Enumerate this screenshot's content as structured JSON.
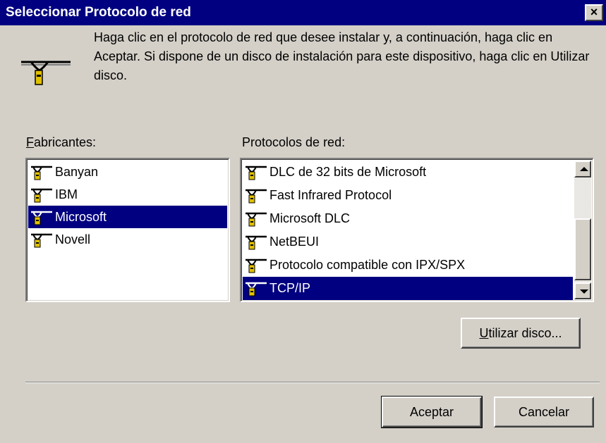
{
  "window": {
    "title": "Seleccionar Protocolo de red",
    "close_glyph": "×"
  },
  "description": "Haga clic en el protocolo de red que desee instalar y, a continuación, haga clic en Aceptar. Si dispone de un disco de instalación para este dispositivo, haga clic en Utilizar disco.",
  "manufacturers": {
    "label_accel": "F",
    "label_rest": "abricantes:",
    "items": [
      "Banyan",
      "IBM",
      "Microsoft",
      "Novell"
    ],
    "selected": "Microsoft"
  },
  "protocols": {
    "label": "Protocolos de red:",
    "items": [
      "DLC de 32 bits de Microsoft",
      "Fast Infrared Protocol",
      "Microsoft DLC",
      "NetBEUI",
      "Protocolo compatible con IPX/SPX",
      "TCP/IP"
    ],
    "selected": "TCP/IP"
  },
  "buttons": {
    "have_disk_accel": "U",
    "have_disk_rest": "tilizar disco...",
    "ok": "Aceptar",
    "cancel": "Cancelar"
  },
  "icons": {
    "protocol": "network-protocol-icon",
    "close": "close-icon"
  },
  "colors": {
    "titlebar": "#000080",
    "selection": "#000080",
    "face": "#d4d0c8"
  }
}
